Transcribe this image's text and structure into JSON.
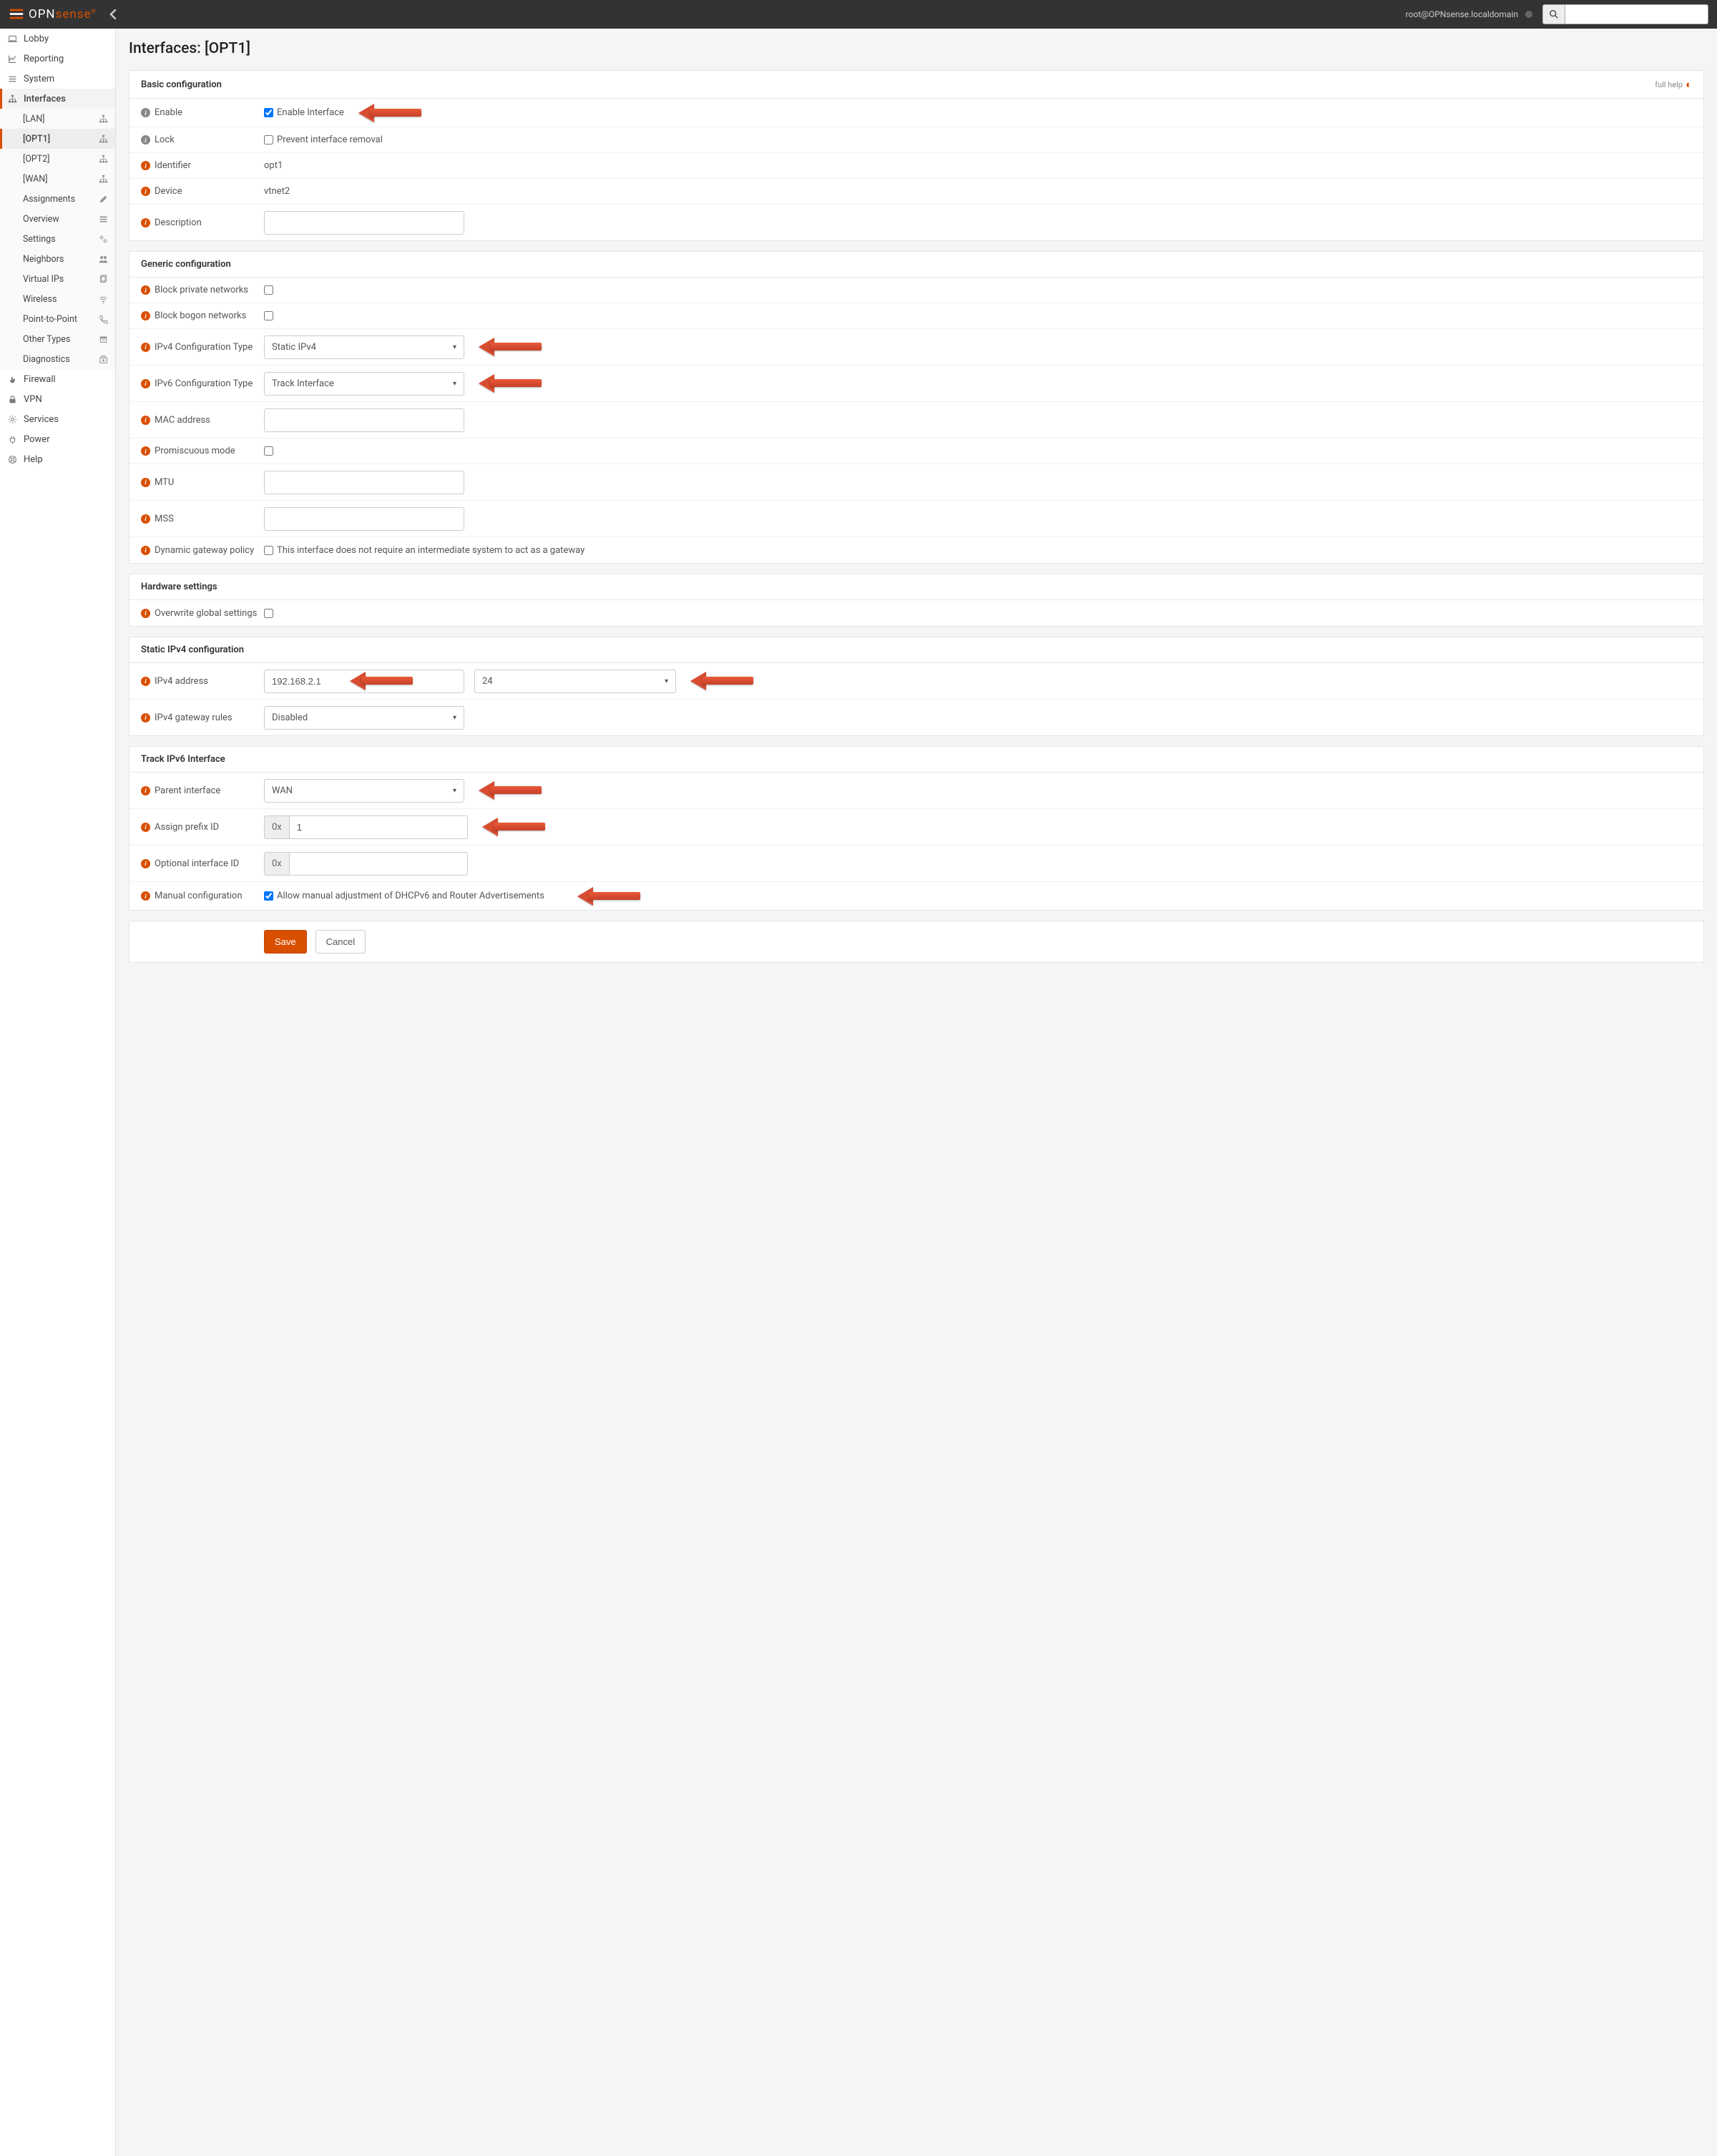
{
  "topbar": {
    "brand_opn": "OPN",
    "brand_sense": "sense",
    "user": "root@OPNsense.localdomain"
  },
  "sidebar": {
    "main": [
      {
        "key": "lobby",
        "label": "Lobby",
        "icon": "laptop"
      },
      {
        "key": "reporting",
        "label": "Reporting",
        "icon": "chart"
      },
      {
        "key": "system",
        "label": "System",
        "icon": "list"
      },
      {
        "key": "interfaces",
        "label": "Interfaces",
        "icon": "sitemap",
        "active": true
      },
      {
        "key": "firewall",
        "label": "Firewall",
        "icon": "fire"
      },
      {
        "key": "vpn",
        "label": "VPN",
        "icon": "lock"
      },
      {
        "key": "services",
        "label": "Services",
        "icon": "gear"
      },
      {
        "key": "power",
        "label": "Power",
        "icon": "plug"
      },
      {
        "key": "help",
        "label": "Help",
        "icon": "life-ring"
      }
    ],
    "interfaces_sub": [
      {
        "key": "lan",
        "label": "[LAN]",
        "icon": "sitemap"
      },
      {
        "key": "opt1",
        "label": "[OPT1]",
        "icon": "sitemap",
        "active": true
      },
      {
        "key": "opt2",
        "label": "[OPT2]",
        "icon": "sitemap"
      },
      {
        "key": "wan",
        "label": "[WAN]",
        "icon": "sitemap"
      },
      {
        "key": "assignments",
        "label": "Assignments",
        "icon": "pencil"
      },
      {
        "key": "overview",
        "label": "Overview",
        "icon": "bars"
      },
      {
        "key": "settings",
        "label": "Settings",
        "icon": "gears"
      },
      {
        "key": "neighbors",
        "label": "Neighbors",
        "icon": "users"
      },
      {
        "key": "virtualips",
        "label": "Virtual IPs",
        "icon": "copy"
      },
      {
        "key": "wireless",
        "label": "Wireless",
        "icon": "wifi"
      },
      {
        "key": "ptp",
        "label": "Point-to-Point",
        "icon": "phone"
      },
      {
        "key": "othertypes",
        "label": "Other Types",
        "icon": "archive"
      },
      {
        "key": "diagnostics",
        "label": "Diagnostics",
        "icon": "medkit"
      }
    ]
  },
  "page": {
    "title": "Interfaces: [OPT1]"
  },
  "sections": {
    "basic": {
      "header": "Basic configuration",
      "full_help": "full help",
      "enable_label": "Enable",
      "enable_cb": "Enable Interface",
      "lock_label": "Lock",
      "lock_cb": "Prevent interface removal",
      "identifier_label": "Identifier",
      "identifier_value": "opt1",
      "device_label": "Device",
      "device_value": "vtnet2",
      "description_label": "Description",
      "description_value": ""
    },
    "generic": {
      "header": "Generic configuration",
      "block_private_label": "Block private networks",
      "block_bogon_label": "Block bogon networks",
      "ipv4_type_label": "IPv4 Configuration Type",
      "ipv4_type_value": "Static IPv4",
      "ipv6_type_label": "IPv6 Configuration Type",
      "ipv6_type_value": "Track Interface",
      "mac_label": "MAC address",
      "mac_value": "",
      "promisc_label": "Promiscuous mode",
      "mtu_label": "MTU",
      "mtu_value": "",
      "mss_label": "MSS",
      "mss_value": "",
      "dyngw_label": "Dynamic gateway policy",
      "dyngw_cb": "This interface does not require an intermediate system to act as a gateway"
    },
    "hardware": {
      "header": "Hardware settings",
      "overwrite_label": "Overwrite global settings"
    },
    "static_ipv4": {
      "header": "Static IPv4 configuration",
      "addr_label": "IPv4 address",
      "addr_value": "192.168.2.1",
      "mask_value": "24",
      "gw_label": "IPv4 gateway rules",
      "gw_value": "Disabled"
    },
    "track_ipv6": {
      "header": "Track IPv6 Interface",
      "parent_label": "Parent interface",
      "parent_value": "WAN",
      "prefix_label": "Assign prefix ID",
      "prefix_addon": "0x",
      "prefix_value": "1",
      "optif_label": "Optional interface ID",
      "optif_addon": "0x",
      "optif_value": "",
      "manual_label": "Manual configuration",
      "manual_cb": "Allow manual adjustment of DHCPv6 and Router Advertisements"
    }
  },
  "buttons": {
    "save": "Save",
    "cancel": "Cancel"
  }
}
